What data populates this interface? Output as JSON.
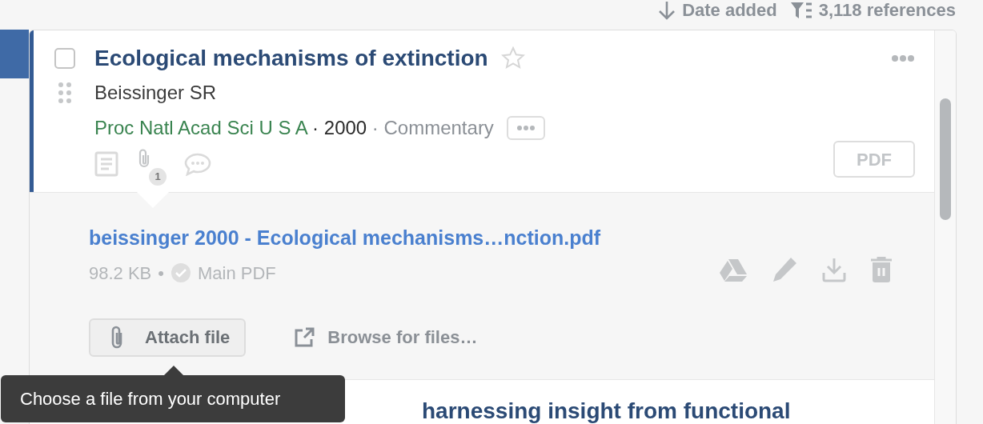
{
  "toolbar": {
    "sort": "Date added",
    "count": "3,118 references"
  },
  "references": [
    {
      "title": "Ecological mechanisms of extinction",
      "selected": true,
      "checked": false,
      "starred": false,
      "expanded": true,
      "authors": "Beissinger SR",
      "citation_separator": "·",
      "journal": "Proc Natl Acad Sci U S A",
      "year": "2000",
      "type": "Commentary",
      "attachment_count": "1",
      "pdf_label": "PDF",
      "attachments": [
        {
          "filename": "beissinger 2000 - Ecological mechanisms…nction.pdf",
          "size": "98.2 KB",
          "separator": "•",
          "main": true,
          "main_label": "Main PDF"
        }
      ],
      "attach_button": "Attach file",
      "browse_link": "Browse for files…"
    },
    {
      "title": "harnessing insight from functional",
      "selected": false
    }
  ],
  "tooltip": "Choose a file from your computer"
}
